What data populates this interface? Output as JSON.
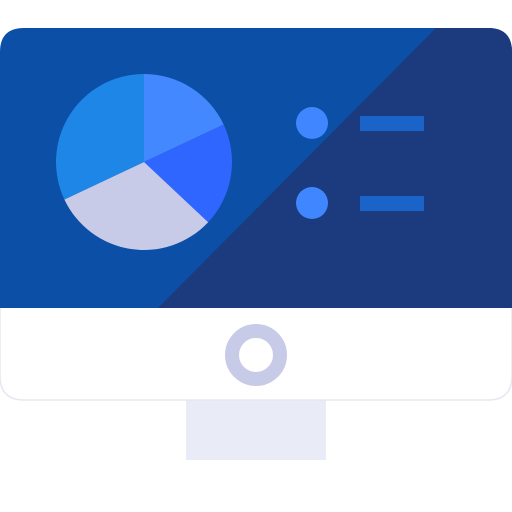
{
  "icon": {
    "name": "desktop-monitor-analytics-icon",
    "colors": {
      "screen_left": "#0b4fa6",
      "screen_right": "#1b3b7e",
      "bezel": "#ffffff",
      "bezel_border": "#e6e8ef",
      "stand": "#e9ebf7",
      "power_ring": "#c8cbe8",
      "legend_dot": "#3f86ff",
      "legend_line": "#1a63c8"
    },
    "pie": {
      "slices": [
        {
          "label": "",
          "share": 0.18,
          "color": "#4488ff"
        },
        {
          "label": "",
          "share": 0.19,
          "color": "#2f66ff"
        },
        {
          "label": "",
          "share": 0.31,
          "color": "#c8cbe8"
        },
        {
          "label": "",
          "share": 0.32,
          "color": "#1e86e6"
        }
      ]
    },
    "legend": [
      {
        "label": ""
      },
      {
        "label": ""
      }
    ]
  }
}
